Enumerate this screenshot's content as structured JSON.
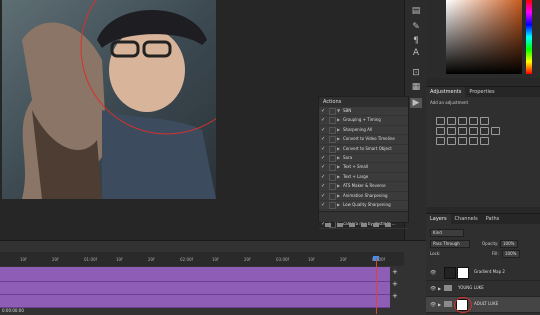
{
  "actions_panel": {
    "title": "Actions",
    "set_name": "SBN",
    "items": [
      "Grouping + Timing",
      "Sharpening All",
      "Convert to Video Timeline",
      "Convert to Smart Object",
      "Sara",
      "Text + Small",
      "Text + Large",
      "ATS Maker & Reverse",
      "Animation Sharpening",
      "Low Quality Sharpening",
      "Smooth Pixels",
      "camera raw by sbstrnm ..."
    ]
  },
  "adjustments_panel": {
    "tabs": [
      "Adjustments",
      "Properties"
    ],
    "subtitle": "Add an adjustment"
  },
  "layers_panel": {
    "tabs": [
      "Layers",
      "Channels",
      "Paths"
    ],
    "filter": "Kind",
    "blend_mode": "Pass Through",
    "opacity_label": "Opacity:",
    "opacity": "100%",
    "lock_label": "Lock:",
    "fill_label": "Fill:",
    "fill": "100%",
    "layers": [
      {
        "name": "Gradient Map 2"
      },
      {
        "name": "YOUNG LUKE"
      },
      {
        "name": "ADULT LUKE"
      }
    ]
  },
  "timeline": {
    "ticks": [
      "10f",
      "20f",
      "01:00f",
      "10f",
      "20f",
      "02:00f",
      "10f",
      "20f",
      "03:00f",
      "10f",
      "20f",
      "04:00f"
    ],
    "status": "0:00:00:00"
  },
  "colors": {
    "accent_purple": "#8e5db5",
    "playhead": "#e0413a",
    "annotation_circle": "#d9302b"
  }
}
